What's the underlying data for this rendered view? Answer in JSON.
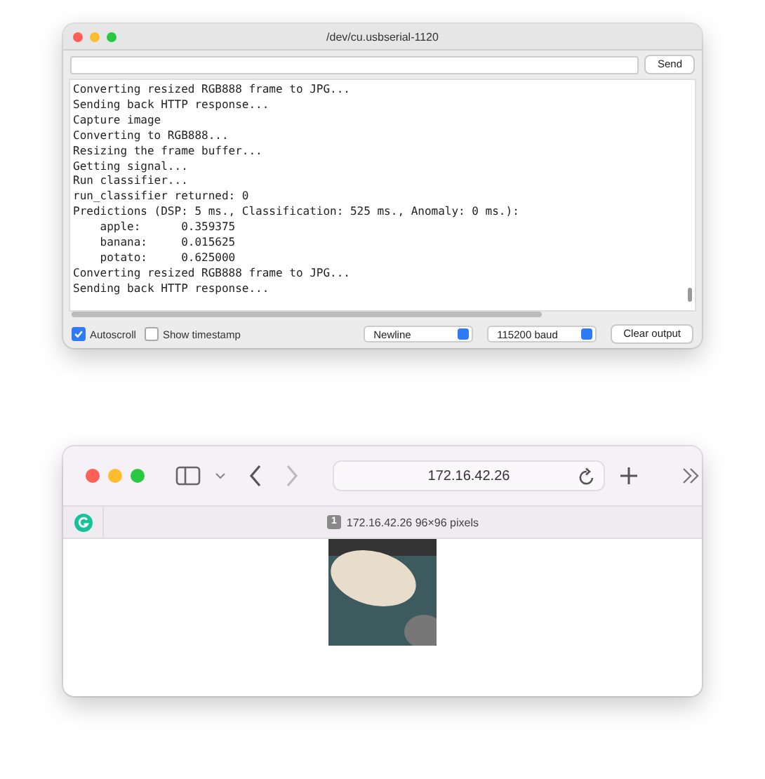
{
  "serial_window": {
    "title": "/dev/cu.usbserial-1120",
    "send_button": "Send",
    "output_lines": [
      "Converting resized RGB888 frame to JPG...",
      "Sending back HTTP response...",
      "Capture image",
      "Converting to RGB888...",
      "Resizing the frame buffer...",
      "Getting signal...",
      "Run classifier...",
      "run_classifier returned: 0",
      "Predictions (DSP: 5 ms., Classification: 525 ms., Anomaly: 0 ms.):",
      "    apple:      0.359375",
      "    banana:     0.015625",
      "    potato:     0.625000",
      "Converting resized RGB888 frame to JPG...",
      "Sending back HTTP response..."
    ],
    "autoscroll": {
      "label": "Autoscroll",
      "checked": true
    },
    "timestamp": {
      "label": "Show timestamp",
      "checked": false
    },
    "line_ending": "Newline",
    "baud_rate": "115200 baud",
    "clear_button": "Clear output"
  },
  "browser_window": {
    "address": "172.16.42.26",
    "tab_badge": "1",
    "tab_title": "172.16.42.26 96×96 pixels"
  }
}
